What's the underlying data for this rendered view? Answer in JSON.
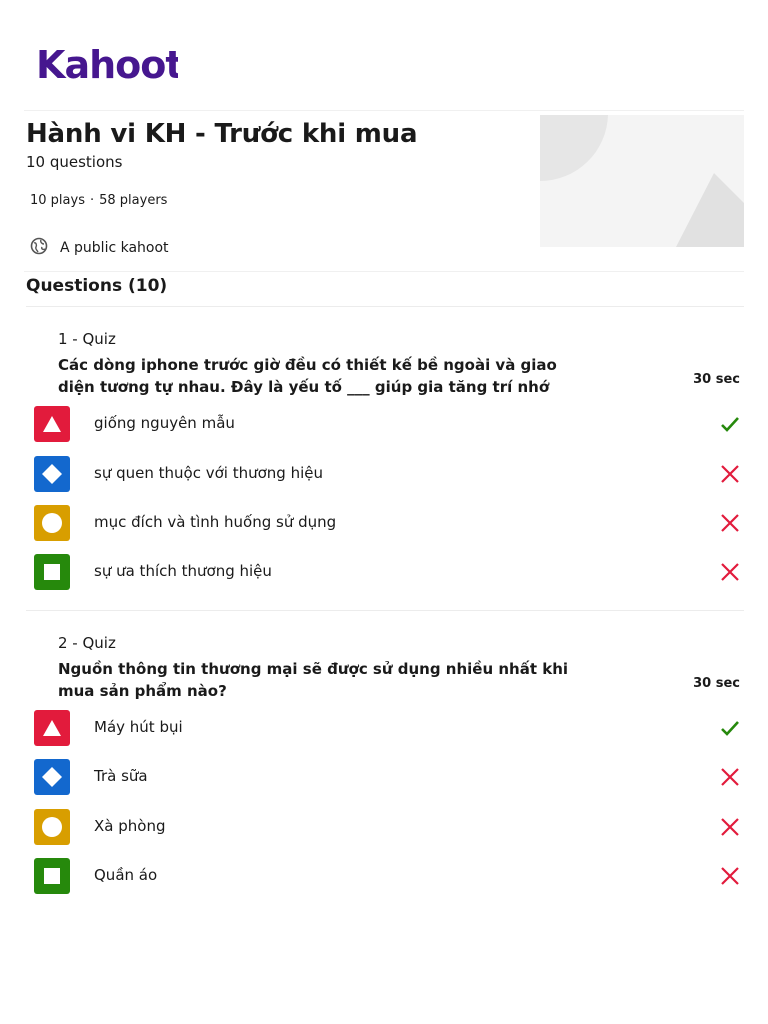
{
  "brand": {
    "logo_text": "Kahoot!",
    "color": "#46178f"
  },
  "kahoot": {
    "title": "Hành vi KH - Trước khi mua",
    "question_count": "10 questions",
    "plays": "10 plays",
    "separator": "·",
    "players": "58 players",
    "visibility": "A public kahoot",
    "visibility_icon": "globe-icon"
  },
  "questions_section": {
    "heading": "Questions (10)"
  },
  "colors": {
    "red": "#e21b3c",
    "blue": "#1368ce",
    "yellow": "#d89e00",
    "green": "#26890c",
    "correct": "#26890c",
    "incorrect": "#e21b3c"
  },
  "questions": [
    {
      "label": "1 - Quiz",
      "text": "Các dòng iphone trước giờ đều có thiết kế bề ngoài và giao diện tương tự nhau. Đây là yếu tố ___ giúp gia tăng trí nhớ",
      "time": "30 sec",
      "answers": [
        {
          "shape": "triangle-icon",
          "text": "giống nguyên mẫu",
          "correct": true
        },
        {
          "shape": "diamond-icon",
          "text": "sự quen thuộc với thương hiệu",
          "correct": false
        },
        {
          "shape": "circle-icon",
          "text": "mục đích và tình huống sử dụng",
          "correct": false
        },
        {
          "shape": "square-icon",
          "text": "sự ưa thích thương hiệu",
          "correct": false
        }
      ]
    },
    {
      "label": "2 - Quiz",
      "text": "Nguồn thông tin thương mại sẽ được sử dụng nhiều nhất khi mua sản phẩm nào?",
      "time": "30 sec",
      "answers": [
        {
          "shape": "triangle-icon",
          "text": "Máy hút bụi",
          "correct": true
        },
        {
          "shape": "diamond-icon",
          "text": "Trà sữa",
          "correct": false
        },
        {
          "shape": "circle-icon",
          "text": "Xà phòng",
          "correct": false
        },
        {
          "shape": "square-icon",
          "text": "Quần áo",
          "correct": false
        }
      ]
    }
  ]
}
